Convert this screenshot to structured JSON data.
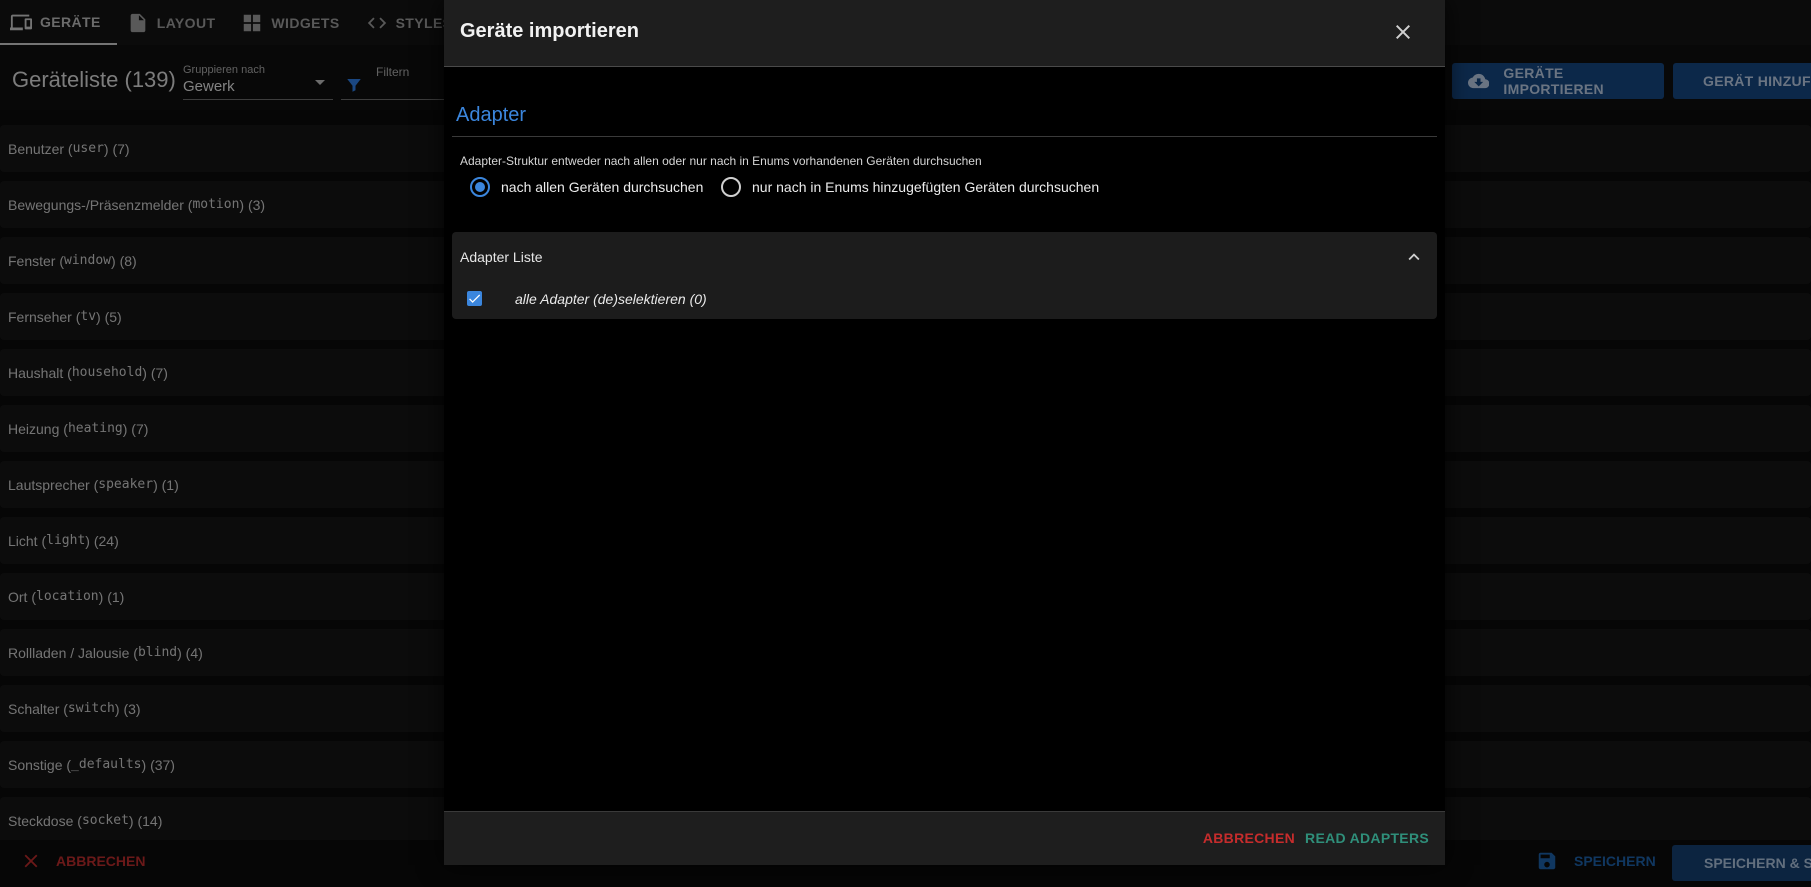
{
  "tabs": [
    {
      "label": "GERÄTE",
      "icon": "devices-icon",
      "active": true
    },
    {
      "label": "LAYOUT",
      "icon": "file-icon",
      "active": false
    },
    {
      "label": "WIDGETS",
      "icon": "grid-icon",
      "active": false
    },
    {
      "label": "STYLES",
      "icon": "code-icon",
      "active": false
    }
  ],
  "header": {
    "title": "Geräteliste (139)",
    "group_by_label": "Gruppieren nach",
    "group_by_value": "Gewerk",
    "filter_placeholder": "Filtern",
    "import_label": "GERÄTE IMPORTIEREN",
    "add_label": "GERÄT HINZUFÜGEN"
  },
  "categories": [
    {
      "name": "Benutzer",
      "code": "user",
      "count": "(7)"
    },
    {
      "name": "Bewegungs-/Präsenzmelder",
      "code": "motion",
      "count": "(3)"
    },
    {
      "name": "Fenster",
      "code": "window",
      "count": "(8)"
    },
    {
      "name": "Fernseher",
      "code": "tv",
      "count": "(5)"
    },
    {
      "name": "Haushalt",
      "code": "household",
      "count": "(7)"
    },
    {
      "name": "Heizung",
      "code": "heating",
      "count": "(7)"
    },
    {
      "name": "Lautsprecher",
      "code": "speaker",
      "count": "(1)"
    },
    {
      "name": "Licht",
      "code": "light",
      "count": "(24)"
    },
    {
      "name": "Ort",
      "code": "location",
      "count": "(1)"
    },
    {
      "name": "Rollladen / Jalousie",
      "code": "blind",
      "count": "(4)"
    },
    {
      "name": "Schalter",
      "code": "switch",
      "count": "(3)"
    },
    {
      "name": "Sonstige",
      "code": "_defaults",
      "count": "(37)"
    },
    {
      "name": "Steckdose",
      "code": "socket",
      "count": "(14)"
    }
  ],
  "footer": {
    "cancel_label": "ABBRECHEN",
    "save_label": "SPEICHERN",
    "save_close_label": "SPEICHERN & SCHLIESSEN"
  },
  "dialog": {
    "title": "Geräte importieren",
    "section_title": "Adapter",
    "radio_group_label": "Adapter-Struktur entweder nach allen oder nur nach in Enums vorhandenen Geräten durchsuchen",
    "radio_options": [
      {
        "label": "nach allen Geräten durchsuchen",
        "checked": true
      },
      {
        "label": "nur nach in Enums hinzugefügten Geräten durchsuchen",
        "checked": false
      }
    ],
    "accordion_title": "Adapter Liste",
    "select_all_label": "alle Adapter (de)selektieren (0)",
    "select_all_checked": true,
    "cancel_label": "ABBRECHEN",
    "read_label": "READ ADAPTERS"
  },
  "colors": {
    "accent": "#3b86dd",
    "danger": "#c62c2c",
    "success": "#2f8f7a",
    "primary_button": "#16467f"
  }
}
